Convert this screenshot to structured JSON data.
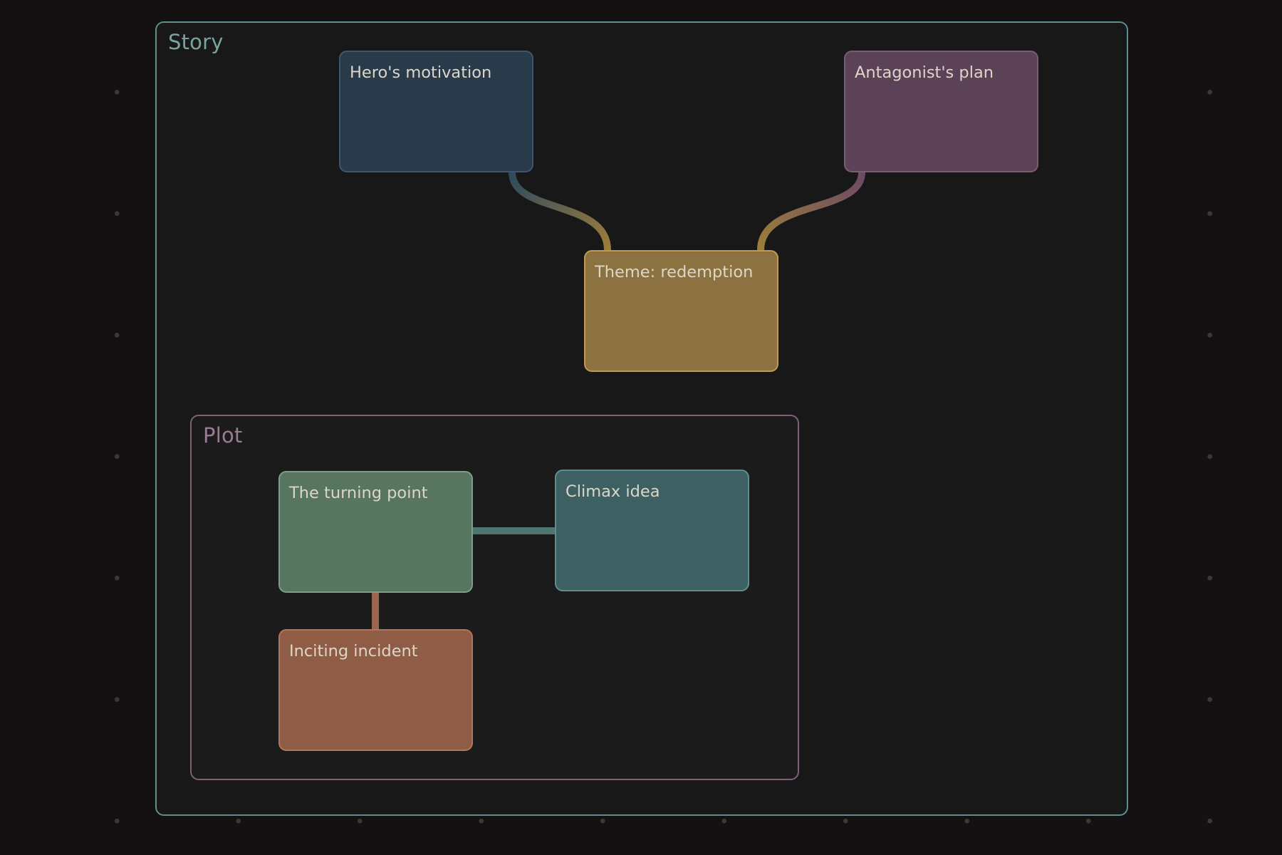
{
  "canvas": {
    "groups": [
      {
        "id": "story",
        "label": "Story",
        "border_color": "#5e8f8c"
      },
      {
        "id": "plot",
        "label": "Plot",
        "border_color": "#7e6078"
      }
    ],
    "cards": [
      {
        "id": "hero",
        "text": "Hero's motivation",
        "color": "#293a4b"
      },
      {
        "id": "antagonist",
        "text": "Antagonist's plan",
        "color": "#5c4256"
      },
      {
        "id": "theme",
        "text": "Theme: redemption",
        "color": "#8b7240"
      },
      {
        "id": "turning",
        "text": "The turning point",
        "color": "#587562"
      },
      {
        "id": "climax",
        "text": "Climax idea",
        "color": "#3d6163"
      },
      {
        "id": "inciting",
        "text": "Inciting incident",
        "color": "#8f5c46"
      }
    ],
    "edges": [
      {
        "from": "Hero's motivation",
        "to": "Theme: redemption"
      },
      {
        "from": "Antagonist's plan",
        "to": "Theme: redemption"
      },
      {
        "from": "The turning point",
        "to": "Climax idea"
      },
      {
        "from": "The turning point",
        "to": "Inciting incident"
      }
    ]
  }
}
